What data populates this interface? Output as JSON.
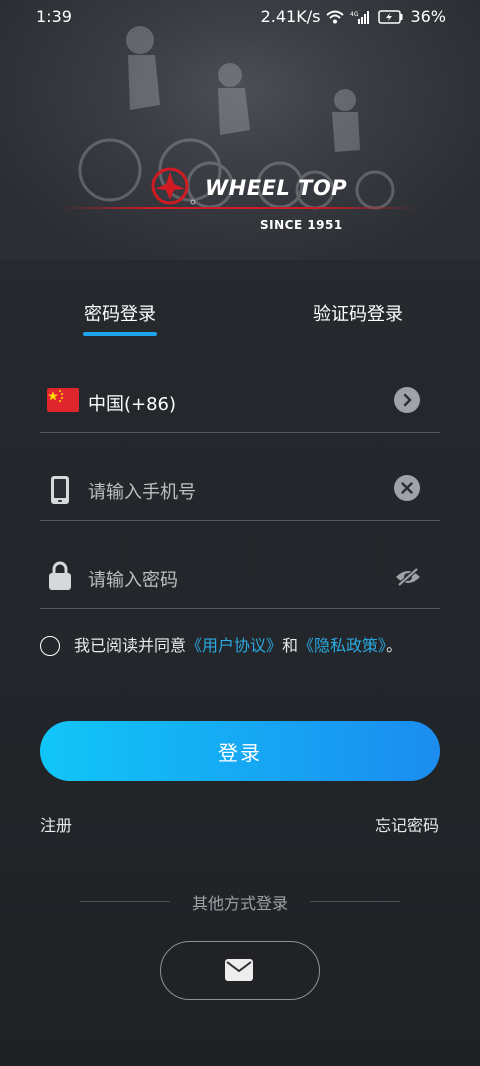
{
  "status": {
    "time": "1:39",
    "net_speed": "2.41K/s",
    "battery": "36%",
    "icons": [
      "wifi-icon",
      "signal-4g-icon",
      "battery-charging-icon"
    ]
  },
  "brand": {
    "name": "WHEEL TOP",
    "since": "SINCE 1951",
    "accent": "#d01a24"
  },
  "tabs": [
    {
      "label": "密码登录",
      "active": true
    },
    {
      "label": "验证码登录",
      "active": false
    }
  ],
  "form": {
    "country": "中国(+86)",
    "phone_placeholder": "请输入手机号",
    "password_placeholder": "请输入密码"
  },
  "agreement": {
    "prefix": "我已阅读并同意",
    "user_agreement": "《用户协议》",
    "and": "和",
    "privacy_policy": "《隐私政策》",
    "suffix": "。"
  },
  "actions": {
    "login": "登录",
    "register": "注册",
    "forgot_password": "忘记密码"
  },
  "other_login": {
    "label": "其他方式登录",
    "methods": [
      "mail-icon"
    ]
  },
  "colors": {
    "primary": "#1b8cf0",
    "link": "#2aa9e0"
  }
}
